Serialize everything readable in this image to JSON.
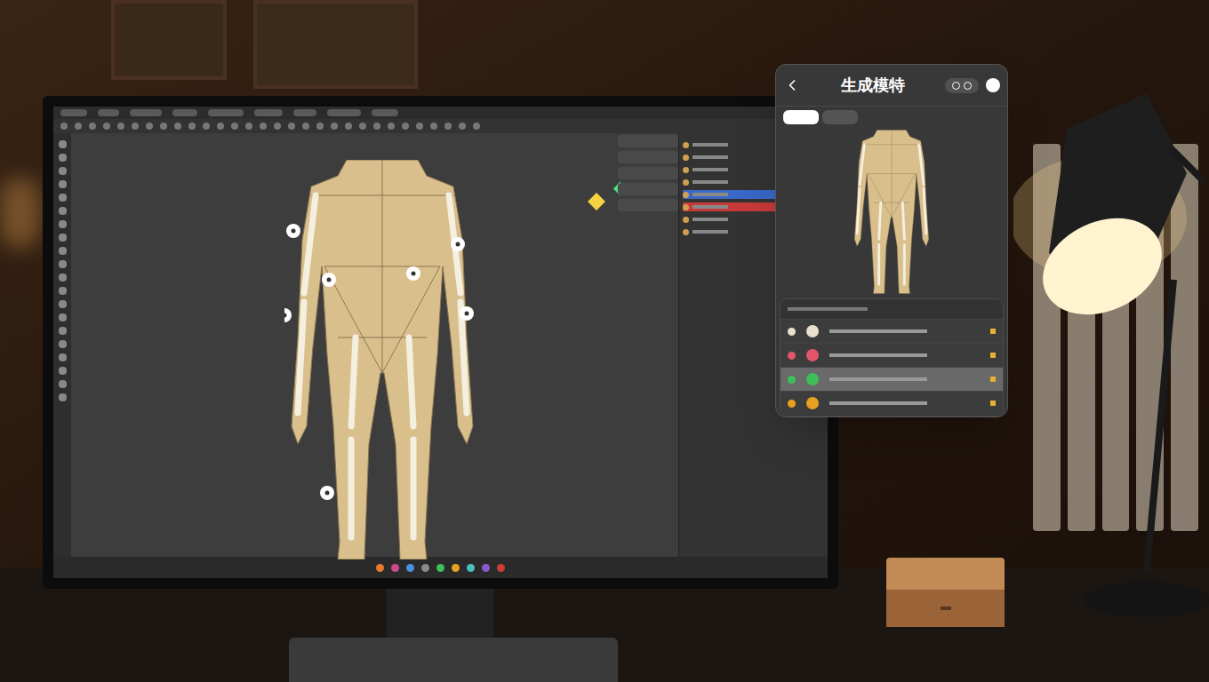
{
  "panel": {
    "title": "生成模特",
    "tabs": [
      {
        "selected": true
      },
      {
        "selected": false
      }
    ],
    "rows": [
      {
        "color": "#e8e0cc",
        "selected": false
      },
      {
        "color": "#e2566b",
        "selected": false
      },
      {
        "color": "#3fbf5a",
        "selected": true
      },
      {
        "color": "#e8a020",
        "selected": false
      }
    ]
  }
}
